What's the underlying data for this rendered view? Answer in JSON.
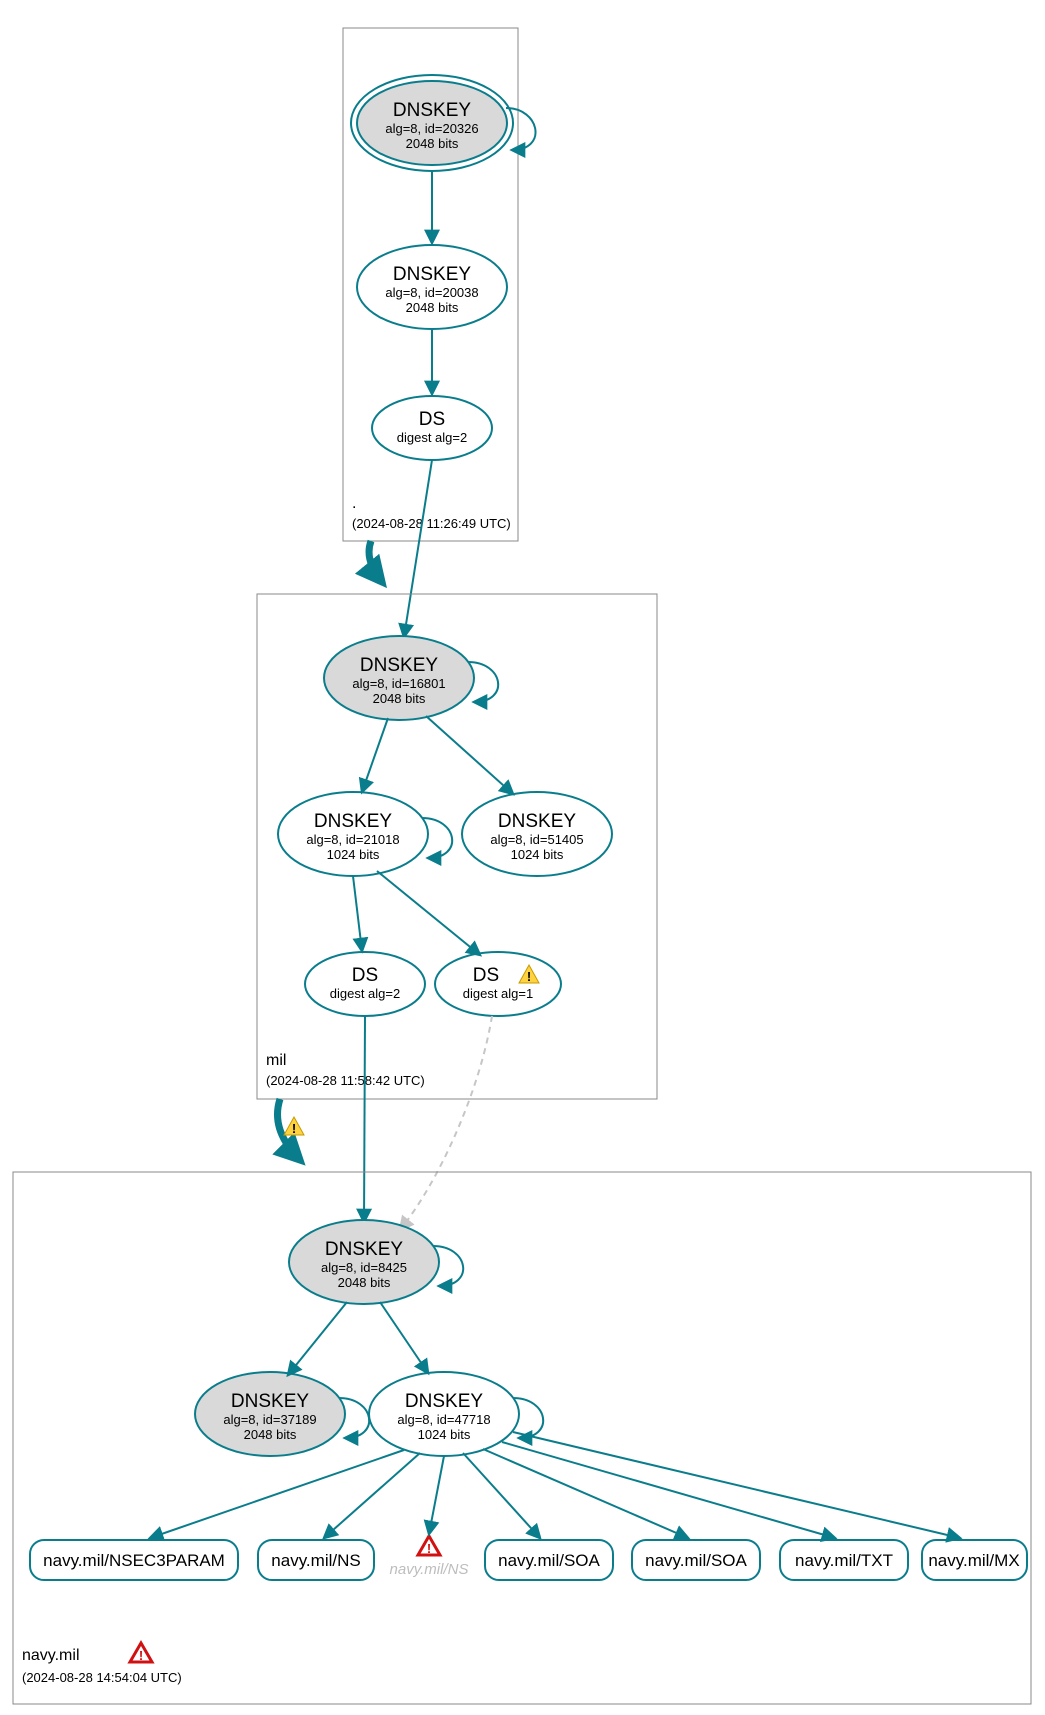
{
  "diagram": {
    "zones": {
      "root": {
        "label": ".",
        "timestamp": "(2024-08-28 11:26:49 UTC)",
        "nodes": {
          "ksk": {
            "title": "DNSKEY",
            "line2": "alg=8, id=20326",
            "line3": "2048 bits"
          },
          "zsk": {
            "title": "DNSKEY",
            "line2": "alg=8, id=20038",
            "line3": "2048 bits"
          },
          "ds": {
            "title": "DS",
            "line2": "digest alg=2"
          }
        }
      },
      "mil": {
        "label": "mil",
        "timestamp": "(2024-08-28 11:58:42 UTC)",
        "nodes": {
          "ksk": {
            "title": "DNSKEY",
            "line2": "alg=8, id=16801",
            "line3": "2048 bits"
          },
          "zskA": {
            "title": "DNSKEY",
            "line2": "alg=8, id=21018",
            "line3": "1024 bits"
          },
          "zskB": {
            "title": "DNSKEY",
            "line2": "alg=8, id=51405",
            "line3": "1024 bits"
          },
          "dsA": {
            "title": "DS",
            "line2": "digest alg=2"
          },
          "dsB": {
            "title": "DS",
            "line2": "digest alg=1"
          }
        }
      },
      "navy": {
        "label": "navy.mil",
        "timestamp": "(2024-08-28 14:54:04 UTC)",
        "nodes": {
          "ksk": {
            "title": "DNSKEY",
            "line2": "alg=8, id=8425",
            "line3": "2048 bits"
          },
          "zskA": {
            "title": "DNSKEY",
            "line2": "alg=8, id=37189",
            "line3": "2048 bits"
          },
          "zskB": {
            "title": "DNSKEY",
            "line2": "alg=8, id=47718",
            "line3": "1024 bits"
          }
        },
        "ghost_ns": "navy.mil/NS",
        "leaves": {
          "nsec3param": "navy.mil/NSEC3PARAM",
          "ns": "navy.mil/NS",
          "soa1": "navy.mil/SOA",
          "soa2": "navy.mil/SOA",
          "txt": "navy.mil/TXT",
          "mx": "navy.mil/MX"
        }
      }
    }
  }
}
